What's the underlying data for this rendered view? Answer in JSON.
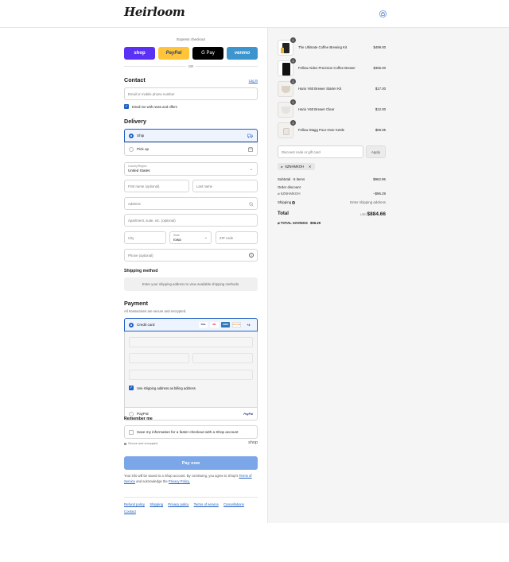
{
  "header": {
    "logo_text": "Heirloom",
    "logo_tagline": "COFFEE ROASTERS",
    "cart_icon": "shopping-bag-icon"
  },
  "express": {
    "title": "Express checkout",
    "buttons": [
      "shop",
      "PayPal",
      "G Pay",
      "venmo"
    ],
    "or": "OR"
  },
  "contact": {
    "title": "Contact",
    "login": "Log in",
    "phone_placeholder": "Email or mobile phone number",
    "newsletter": "Email me with news and offers"
  },
  "delivery": {
    "title": "Delivery",
    "ship": "Ship",
    "pickup": "Pick up",
    "country_label": "Country/Region",
    "country_value": "United States",
    "first_name": "First name (optional)",
    "last_name": "Last name",
    "address": "Address",
    "apartment": "Apartment, suite, etc. (optional)",
    "city": "City",
    "state_label": "State",
    "state_value": "Iowa",
    "zip": "ZIP code",
    "phone": "Phone (optional)"
  },
  "shipping_method": {
    "title": "Shipping method",
    "info": "Enter your shipping address to view available shipping methods."
  },
  "payment": {
    "title": "Payment",
    "subtitle": "All transactions are secure and encrypted.",
    "credit_card": "Credit card",
    "card_logos": [
      "VISA",
      "MC",
      "AMEX",
      "DISCOVER",
      "+4"
    ],
    "billing_same": "Use shipping address as billing address",
    "paypal": "PayPal",
    "paypal_logo": "PayPal"
  },
  "remember": {
    "title": "Remember me",
    "save_info": "Save my information for a faster checkout with a Shop account",
    "secure": "Secure and encrypted",
    "shop_logo": "shop"
  },
  "pay_now": "Pay now",
  "legal": {
    "text": "Your info will be saved to a Shop account. By continuing, you agree to Shop's",
    "terms": "Terms of Service",
    "and": "and acknowledge the",
    "privacy": "Privacy Policy."
  },
  "footer": [
    "Refund policy",
    "Shipping",
    "Privacy policy",
    "Terms of service",
    "Cancellations",
    "Contact"
  ],
  "cart": {
    "items": [
      {
        "qty": "1",
        "name": "The Ultimate Coffee Brewing Kit",
        "price": "$499.00"
      },
      {
        "qty": "1",
        "name": "Fellow Aiden Precision Coffee Brewer",
        "price": "$365.00"
      },
      {
        "qty": "1",
        "name": "Hario V60 Brewer Starter Kit",
        "price": "$17.00"
      },
      {
        "qty": "1",
        "name": "Hario V60 Brewer Clear",
        "price": "$12.00"
      },
      {
        "qty": "1",
        "name": "Fellow Stagg Pour-Over Kettle",
        "price": "$69.95"
      }
    ],
    "discount_placeholder": "Discount code or gift card",
    "apply": "Apply",
    "applied_code": "6ZNHMKOH",
    "subtotal_label": "Subtotal · 5 items",
    "subtotal": "$962.95",
    "order_discount": "Order discount",
    "discount_code": "6ZNHMKOH",
    "discount_value": "−$96.29",
    "shipping_label": "Shipping",
    "shipping_value": "Enter shipping address",
    "total_label": "Total",
    "currency": "USD",
    "total": "$884.66",
    "savings_label": "TOTAL SAVINGS",
    "savings": "$96.29"
  }
}
